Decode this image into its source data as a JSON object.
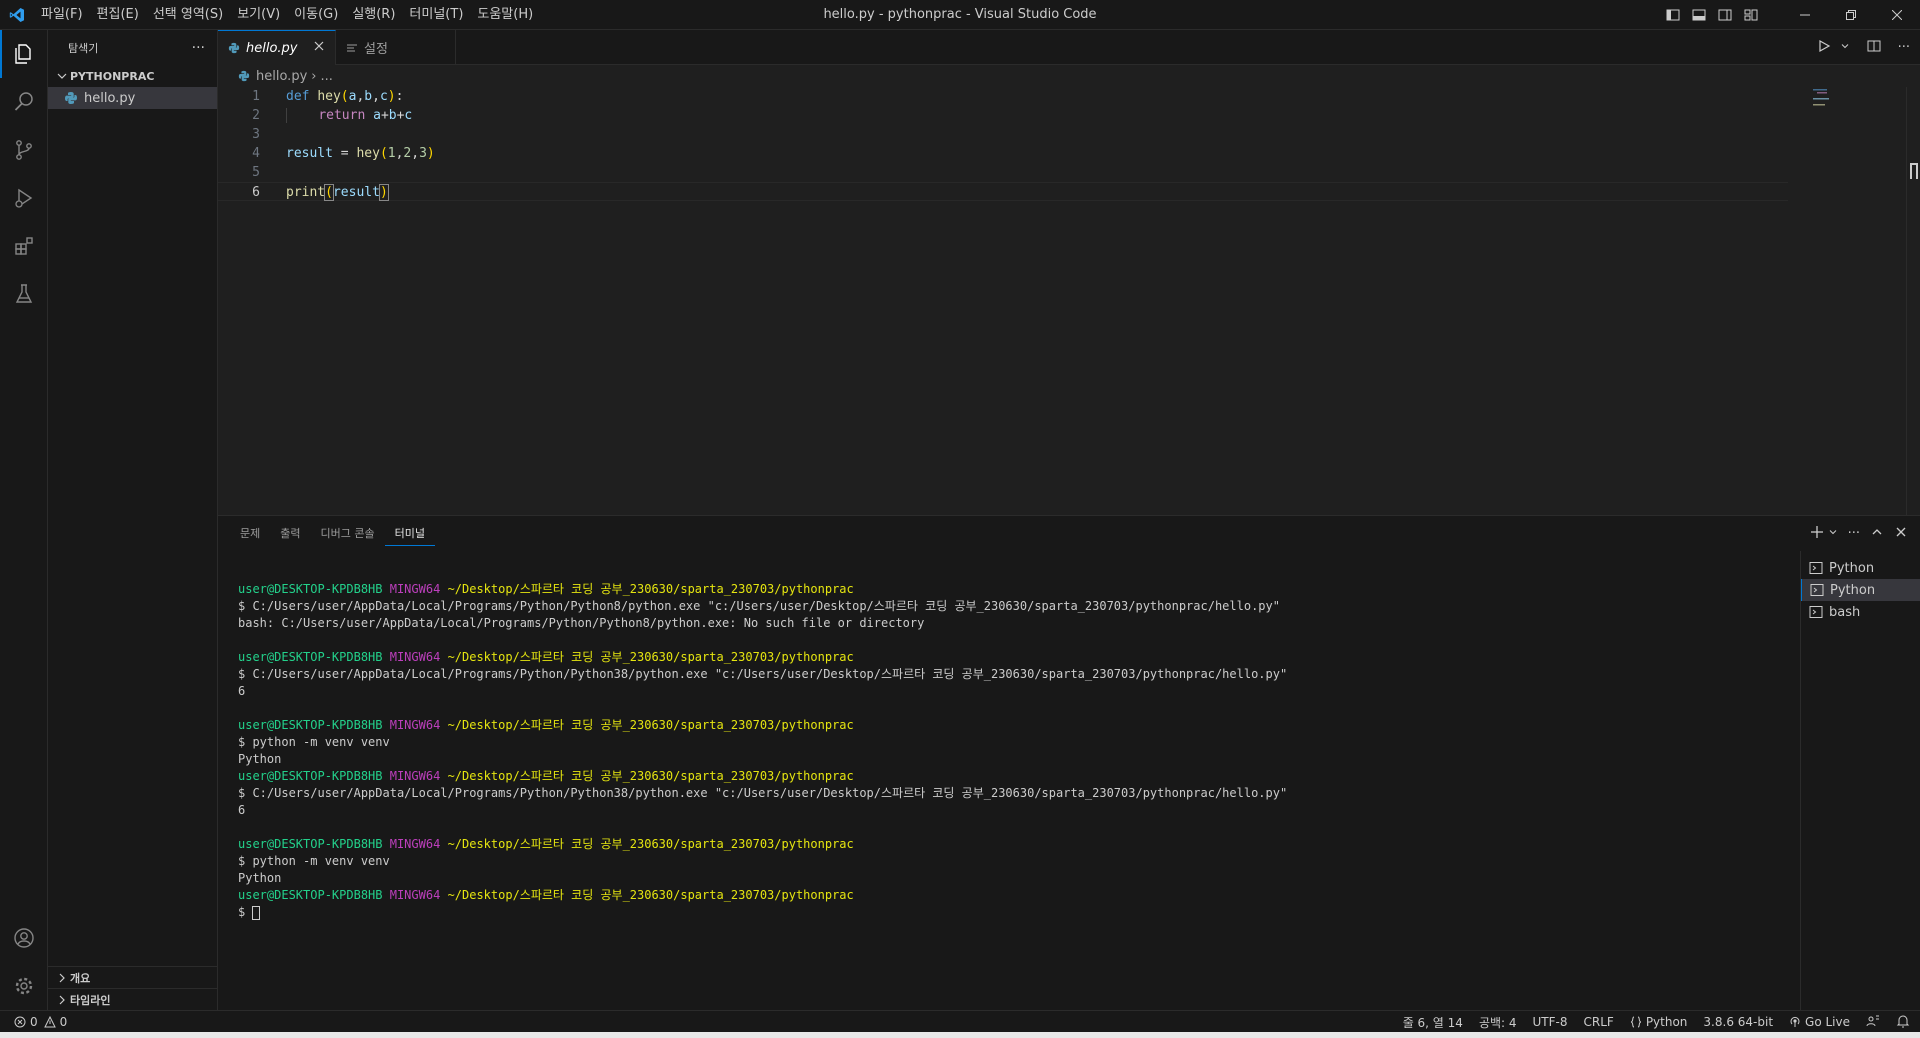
{
  "window": {
    "title": "hello.py - pythonprac - Visual Studio Code"
  },
  "menu": {
    "items": [
      "파일(F)",
      "편집(E)",
      "선택 영역(S)",
      "보기(V)",
      "이동(G)",
      "실행(R)",
      "터미널(T)",
      "도움말(H)"
    ]
  },
  "sidebar": {
    "title": "탐색기",
    "more": "···",
    "folder": "PYTHONPRAC",
    "file": "hello.py",
    "outline": "개요",
    "timeline": "타임라인"
  },
  "tabs": [
    {
      "label": "hello.py",
      "icon": "python-file-icon",
      "active": true
    },
    {
      "label": "설정",
      "icon": "settings-list-icon",
      "active": false
    }
  ],
  "breadcrumb": {
    "file": "hello.py",
    "sep": "›",
    "more": "..."
  },
  "editor": {
    "line_numbers": [
      "1",
      "2",
      "3",
      "4",
      "5",
      "6"
    ],
    "current_line": 6
  },
  "panel": {
    "tabs": [
      "문제",
      "출력",
      "디버그 콘솔",
      "터미널"
    ],
    "active_tab": "터미널",
    "terminal_lines": [
      {
        "type": "prompt",
        "user": "user@DESKTOP-KPDB8HB",
        "host": "MINGW64",
        "path": "~/Desktop/스파르타 코딩 공부_230630/sparta_230703/pythonprac"
      },
      {
        "type": "text",
        "text": "$ C:/Users/user/AppData/Local/Programs/Python/Python8/python.exe \"c:/Users/user/Desktop/스파르타 코딩 공부_230630/sparta_230703/pythonprac/hello.py\""
      },
      {
        "type": "text",
        "text": "bash: C:/Users/user/AppData/Local/Programs/Python/Python8/python.exe: No such file or directory"
      },
      {
        "type": "blank",
        "text": ""
      },
      {
        "type": "prompt",
        "user": "user@DESKTOP-KPDB8HB",
        "host": "MINGW64",
        "path": "~/Desktop/스파르타 코딩 공부_230630/sparta_230703/pythonprac"
      },
      {
        "type": "text",
        "text": "$ C:/Users/user/AppData/Local/Programs/Python/Python38/python.exe \"c:/Users/user/Desktop/스파르타 코딩 공부_230630/sparta_230703/pythonprac/hello.py\""
      },
      {
        "type": "text",
        "text": "6"
      },
      {
        "type": "blank",
        "text": ""
      },
      {
        "type": "prompt",
        "user": "user@DESKTOP-KPDB8HB",
        "host": "MINGW64",
        "path": "~/Desktop/스파르타 코딩 공부_230630/sparta_230703/pythonprac"
      },
      {
        "type": "text",
        "text": "$ python -m venv venv"
      },
      {
        "type": "text",
        "text": "Python"
      },
      {
        "type": "prompt",
        "user": "user@DESKTOP-KPDB8HB",
        "host": "MINGW64",
        "path": "~/Desktop/스파르타 코딩 공부_230630/sparta_230703/pythonprac"
      },
      {
        "type": "text",
        "text": "$ C:/Users/user/AppData/Local/Programs/Python/Python38/python.exe \"c:/Users/user/Desktop/스파르타 코딩 공부_230630/sparta_230703/pythonprac/hello.py\""
      },
      {
        "type": "text",
        "text": "6"
      },
      {
        "type": "blank",
        "text": ""
      },
      {
        "type": "prompt",
        "user": "user@DESKTOP-KPDB8HB",
        "host": "MINGW64",
        "path": "~/Desktop/스파르타 코딩 공부_230630/sparta_230703/pythonprac"
      },
      {
        "type": "text",
        "text": "$ python -m venv venv"
      },
      {
        "type": "text",
        "text": "Python"
      },
      {
        "type": "prompt",
        "user": "user@DESKTOP-KPDB8HB",
        "host": "MINGW64",
        "path": "~/Desktop/스파르타 코딩 공부_230630/sparta_230703/pythonprac"
      }
    ],
    "final_prompt": "$ ",
    "terminals": [
      {
        "label": "Python",
        "selected": false
      },
      {
        "label": "Python",
        "selected": true
      },
      {
        "label": "bash",
        "selected": false
      }
    ]
  },
  "status": {
    "errors": "0",
    "warnings": "0",
    "position": "줄 6, 열 14",
    "spaces": "공백: 4",
    "encoding": "UTF-8",
    "eol": "CRLF",
    "language": "Python",
    "interpreter": "3.8.6 64-bit",
    "golive": "Go Live"
  },
  "colors": {
    "accent": "#0078d4",
    "background": "#1f1f1f",
    "chrome": "#181818"
  }
}
